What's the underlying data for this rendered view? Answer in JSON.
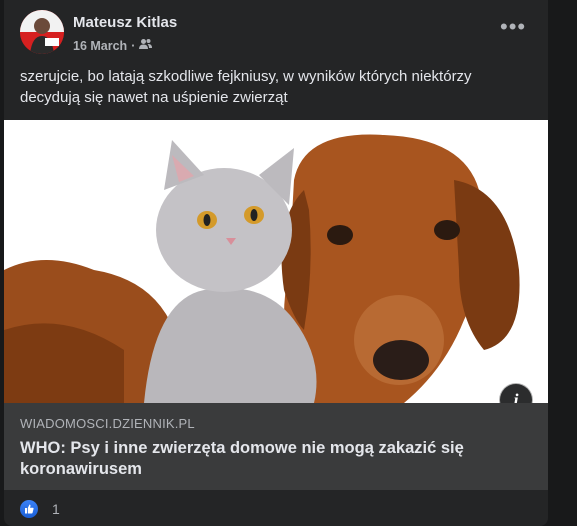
{
  "post": {
    "author": "Mateusz Kitlas",
    "date": "16 March",
    "separator": "·",
    "audience_icon": "friends-icon",
    "more_icon": "more-options-icon",
    "text": "szerujcie, bo latają szkodliwe fejkniusy, w wyników których niektórzy decydują się nawet na uśpienie zwierząt"
  },
  "link_preview": {
    "image_desc_icon": "cat-and-dog-photo",
    "domain": "WIADOMOSCI.DZIENNIK.PL",
    "headline": "WHO: Psy i inne zwierzęta domowe nie mogą zakazić się koronawirusem",
    "info_icon_glyph": "i"
  },
  "reactions": {
    "icon": "like-icon",
    "count": "1"
  },
  "colors": {
    "page_bg": "#18191a",
    "card_bg": "#242526",
    "link_box_bg": "#3a3b3c",
    "primary_text": "#e4e6eb",
    "secondary_text": "#b0b3b8",
    "like_blue": "#1877f2"
  }
}
